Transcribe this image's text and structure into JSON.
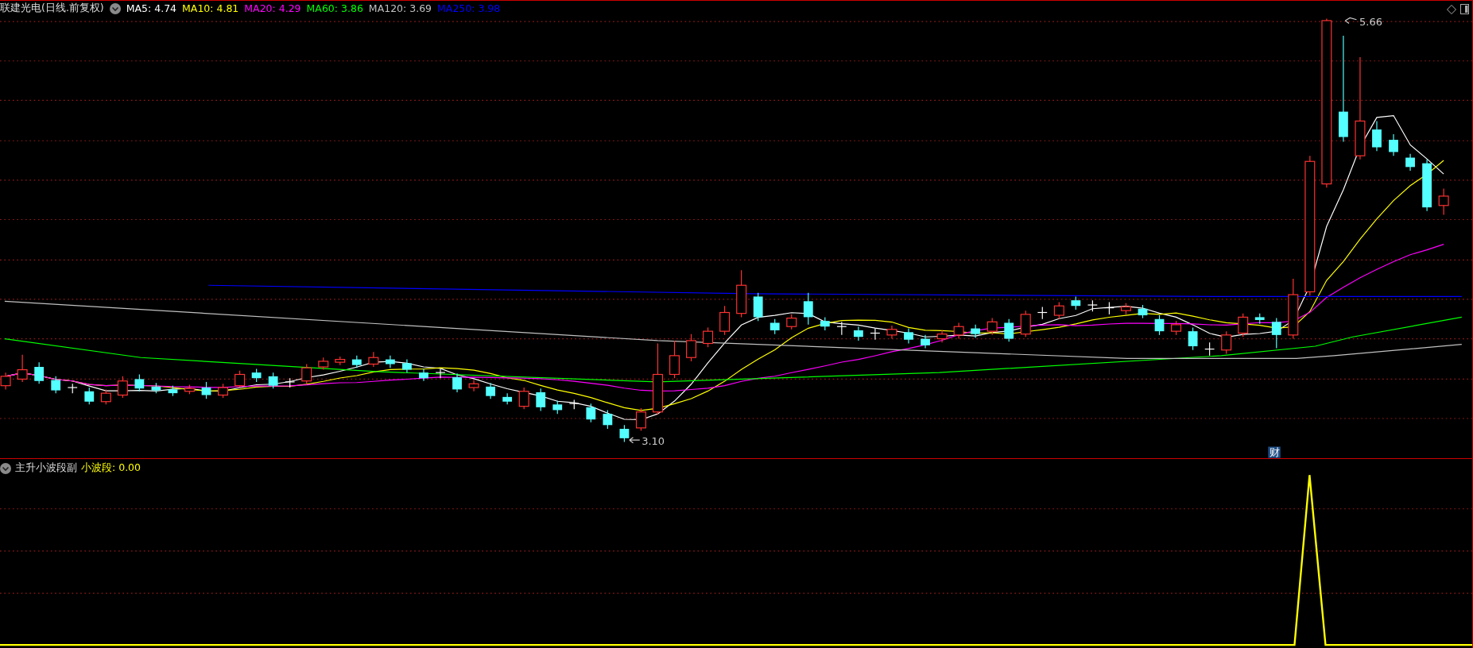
{
  "chart_header": {
    "title": "联建光电(日线.前复权)",
    "moving_averages": [
      {
        "label": "MA5: 4.74",
        "color": "#ffffff"
      },
      {
        "label": "MA10: 4.81",
        "color": "#ffff00"
      },
      {
        "label": "MA20: 4.29",
        "color": "#ff00ff"
      },
      {
        "label": "MA60: 3.86",
        "color": "#00ff00"
      },
      {
        "label": "MA120: 3.69",
        "color": "#c0c0c0"
      },
      {
        "label": "MA250: 3.98",
        "color": "#0000ff"
      }
    ]
  },
  "price_chart": {
    "high_marker": "5.66",
    "low_marker": "3.10",
    "event_marker": "财"
  },
  "indicator_panel": {
    "name": "主升小波段副",
    "readout": "小波段: 0.00"
  }
}
